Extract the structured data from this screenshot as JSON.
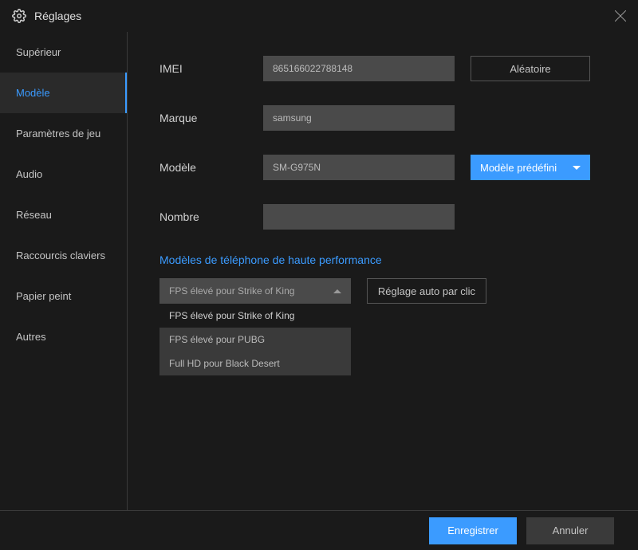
{
  "header": {
    "title": "Réglages"
  },
  "sidebar": {
    "items": [
      {
        "label": "Supérieur"
      },
      {
        "label": "Modèle"
      },
      {
        "label": "Paramètres de jeu"
      },
      {
        "label": "Audio"
      },
      {
        "label": "Réseau"
      },
      {
        "label": "Raccourcis claviers"
      },
      {
        "label": "Papier peint"
      },
      {
        "label": "Autres"
      }
    ]
  },
  "form": {
    "imei": {
      "label": "IMEI",
      "value": "865166022788148",
      "button": "Aléatoire"
    },
    "brand": {
      "label": "Marque",
      "value": "samsung"
    },
    "model": {
      "label": "Modèle",
      "value": "SM-G975N",
      "preset": "Modèle prédéfini"
    },
    "number": {
      "label": "Nombre",
      "value": ""
    },
    "perf": {
      "title": "Modèles de téléphone de haute performance",
      "selected": "FPS élevé pour Strike of King",
      "button": "Réglage auto par clic",
      "options": [
        "FPS élevé pour Strike of King",
        "FPS élevé pour PUBG",
        "Full HD pour Black Desert"
      ]
    }
  },
  "footer": {
    "save": "Enregistrer",
    "cancel": "Annuler"
  }
}
